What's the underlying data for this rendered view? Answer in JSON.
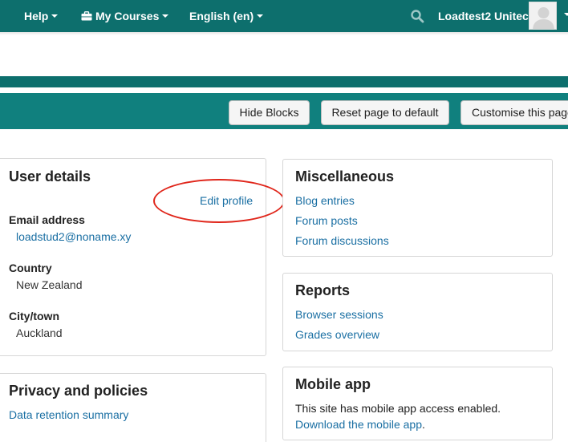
{
  "navbar": {
    "help_label": "Help",
    "my_courses_label": "My Courses",
    "language_label": "English (en)",
    "user_name": "Loadtest2 Unitec"
  },
  "page_actions": {
    "hide_blocks": "Hide Blocks",
    "reset_page": "Reset page to default",
    "customise_page": "Customise this page"
  },
  "user_details": {
    "title": "User details",
    "edit_profile": "Edit profile",
    "email_label": "Email address",
    "email_value": "loadstud2@noname.xy",
    "country_label": "Country",
    "country_value": "New Zealand",
    "city_label": "City/town",
    "city_value": "Auckland"
  },
  "privacy": {
    "title": "Privacy and policies",
    "data_retention": "Data retention summary"
  },
  "miscellaneous": {
    "title": "Miscellaneous",
    "blog_entries": "Blog entries",
    "forum_posts": "Forum posts",
    "forum_discussions": "Forum discussions"
  },
  "reports": {
    "title": "Reports",
    "browser_sessions": "Browser sessions",
    "grades_overview": "Grades overview"
  },
  "mobile_app": {
    "title": "Mobile app",
    "description": "This site has mobile app access enabled.",
    "download_link": "Download the mobile app",
    "trailing_period": "."
  },
  "colors": {
    "navbar": "#0d6f6d",
    "header_band": "#10807e",
    "link": "#1a6fa3",
    "annotation": "#e0261b"
  }
}
